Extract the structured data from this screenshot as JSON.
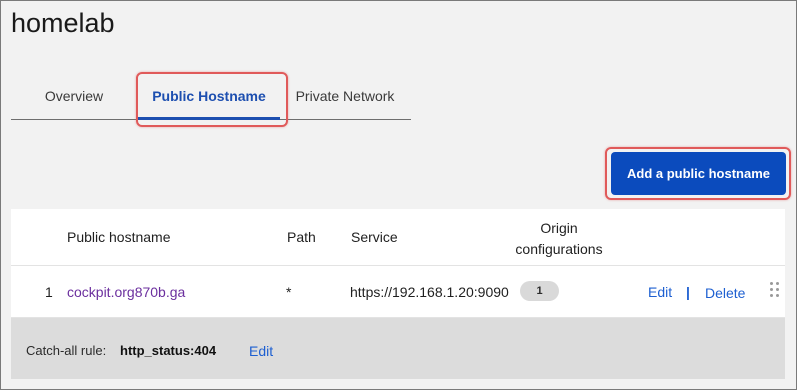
{
  "page": {
    "title": "homelab"
  },
  "tabs": [
    {
      "label": "Overview",
      "active": false
    },
    {
      "label": "Public Hostname",
      "active": true
    },
    {
      "label": "Private Network",
      "active": false
    }
  ],
  "toolbar": {
    "add_label": "Add a public hostname"
  },
  "table": {
    "headers": {
      "hostname": "Public hostname",
      "path": "Path",
      "service": "Service",
      "origin_line1": "Origin",
      "origin_line2": "configurations"
    },
    "rows": [
      {
        "index": "1",
        "hostname": "cockpit.org870b.ga",
        "path": "*",
        "service": "https://192.168.1.20:9090",
        "origin_count": "1",
        "edit_label": "Edit",
        "separator": "|",
        "delete_label": "Delete"
      }
    ]
  },
  "catchall": {
    "label": "Catch-all rule:",
    "value": "http_status:404",
    "edit_label": "Edit"
  },
  "colors": {
    "accent": "#0b4bbd",
    "active_tab": "#1d4fb0",
    "link": "#1d5fd1",
    "visited_link": "#6b2f9e",
    "highlight": "#e05a5a"
  }
}
